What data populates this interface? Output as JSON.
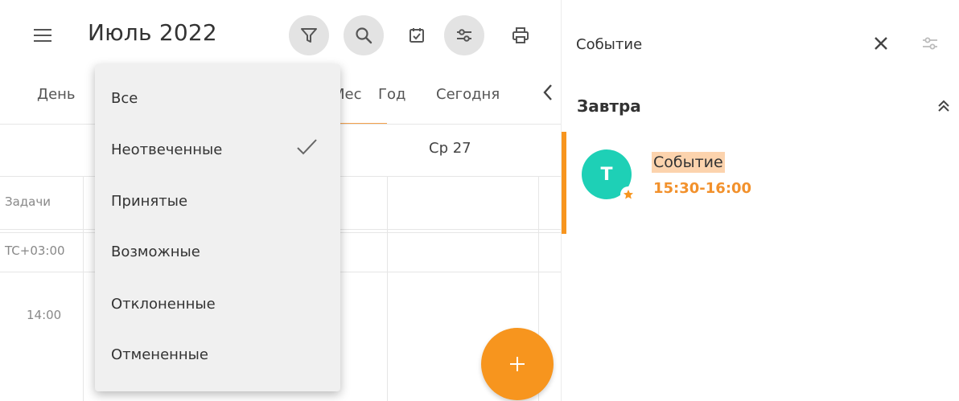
{
  "header": {
    "month_title": "Июль 2022"
  },
  "tabs": [
    {
      "label": "День"
    },
    {
      "label": "Мес"
    },
    {
      "label": "Год"
    },
    {
      "label": "Сегодня"
    }
  ],
  "grid": {
    "day_header": "Ср 27",
    "tasks_label": "Задачи",
    "timezone_label": "TC+03:00",
    "hour_label": "14:00"
  },
  "filter_menu": {
    "items": [
      {
        "label": "Все"
      },
      {
        "label": "Неотвеченные",
        "checked": true
      },
      {
        "label": "Принятые"
      },
      {
        "label": "Возможные"
      },
      {
        "label": "Отклоненные"
      },
      {
        "label": "Отмененные"
      }
    ]
  },
  "fab": {
    "label": "+"
  },
  "panel": {
    "title": "Событие",
    "section_title": "Завтра",
    "event": {
      "avatar_letter": "Т",
      "name": "Событие",
      "time": "15:30-16:00"
    }
  },
  "colors": {
    "accent": "#f7951e",
    "avatar": "#1ed0b6",
    "event_highlight": "#fcd3ad",
    "event_time": "#f2912c",
    "active_tool_bg": "#e3e3e3"
  },
  "icons": [
    "menu-icon",
    "filter-icon",
    "search-icon",
    "calendar-check-icon",
    "sliders-icon",
    "print-icon",
    "chevron-left-icon",
    "check-icon",
    "plus-icon",
    "close-icon",
    "settings-sliders-icon",
    "double-chevron-up-icon",
    "star-icon"
  ]
}
